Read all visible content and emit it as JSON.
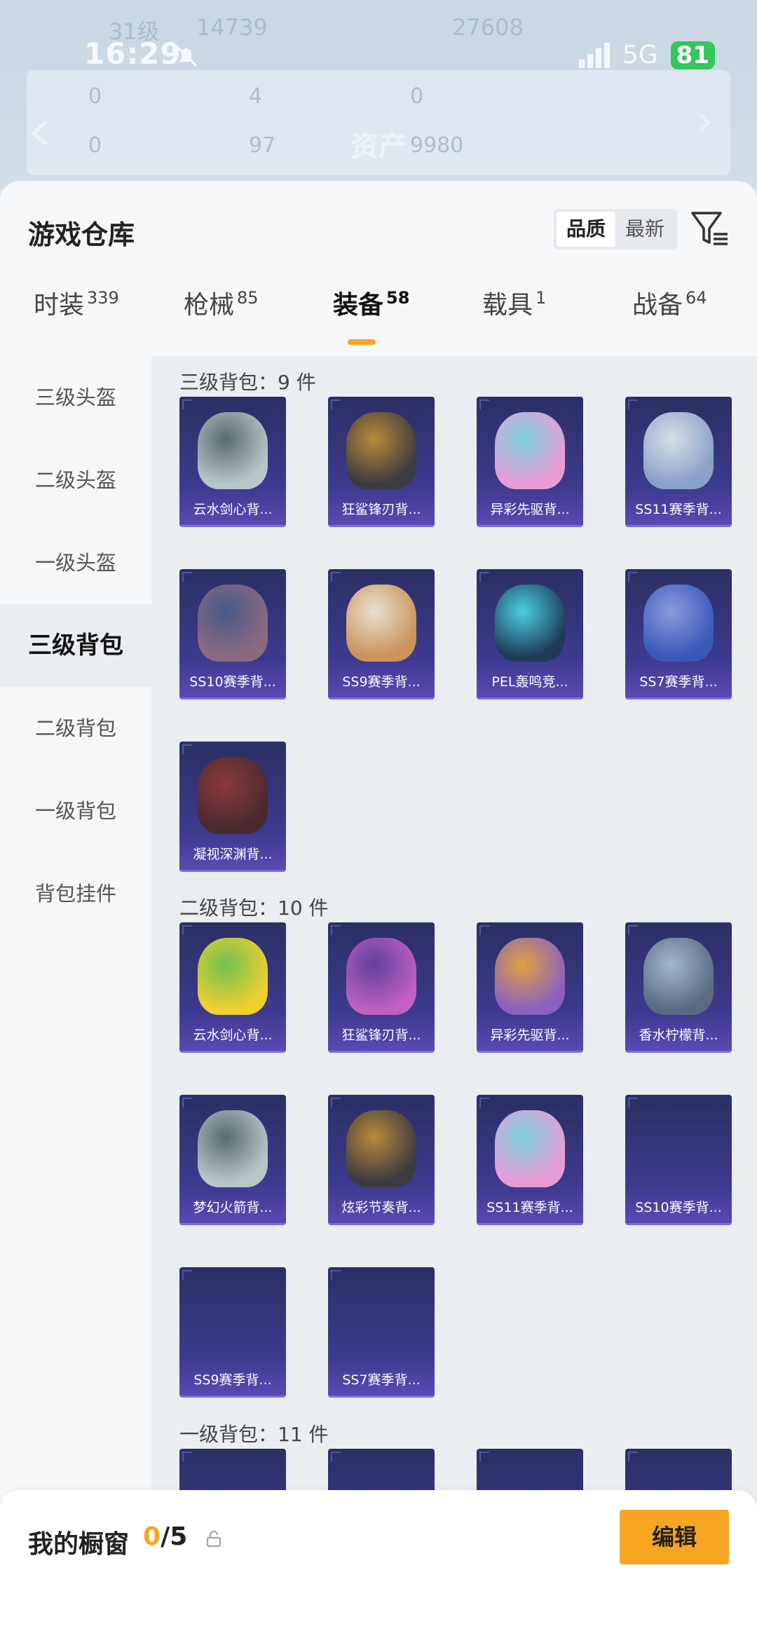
{
  "status_bar": {
    "time": "16:29",
    "network": "5G",
    "battery": "81"
  },
  "background_header": {
    "level": "31级",
    "points": "14739",
    "score": "27608",
    "stats": [
      "0",
      "4",
      "0",
      "0",
      "97"
    ],
    "assets_label": "资产",
    "assets_value": "9980"
  },
  "sheet": {
    "title": "游戏仓库",
    "sort_options": [
      "品质",
      "最新"
    ],
    "active_sort": "品质"
  },
  "tabs": [
    {
      "label": "时装",
      "count": "339"
    },
    {
      "label": "枪械",
      "count": "85"
    },
    {
      "label": "装备",
      "count": "58",
      "active": true
    },
    {
      "label": "载具",
      "count": "1"
    },
    {
      "label": "战备",
      "count": "64"
    }
  ],
  "sidebar": {
    "items": [
      "三级头盔",
      "二级头盔",
      "一级头盔",
      "三级背包",
      "二级背包",
      "一级背包",
      "背包挂件"
    ],
    "active": "三级背包"
  },
  "groups": [
    {
      "title": "三级背包：9 件",
      "items": [
        "云水剑心背...",
        "狂鲨锋刃背...",
        "异彩先驱背...",
        "SS11赛季背...",
        "SS10赛季背...",
        "SS9赛季背...",
        "PEL轰鸣竞...",
        "SS7赛季背...",
        "凝视深渊背..."
      ]
    },
    {
      "title": "二级背包：10 件",
      "items": [
        "云水剑心背...",
        "狂鲨锋刃背...",
        "异彩先驱背...",
        "香水柠檬背...",
        "梦幻火箭背...",
        "炫彩节奏背...",
        "SS11赛季背...",
        "SS10赛季背...",
        "SS9赛季背...",
        "SS7赛季背..."
      ]
    },
    {
      "title": "一级背包：11 件",
      "items": []
    }
  ],
  "bottom_bar": {
    "label": "我的橱窗",
    "current": "0",
    "total": "/5",
    "edit_label": "编辑"
  },
  "colors": {
    "accent": "#f6a623",
    "card_bg": "#3d3a8e",
    "battery": "#34c759"
  }
}
